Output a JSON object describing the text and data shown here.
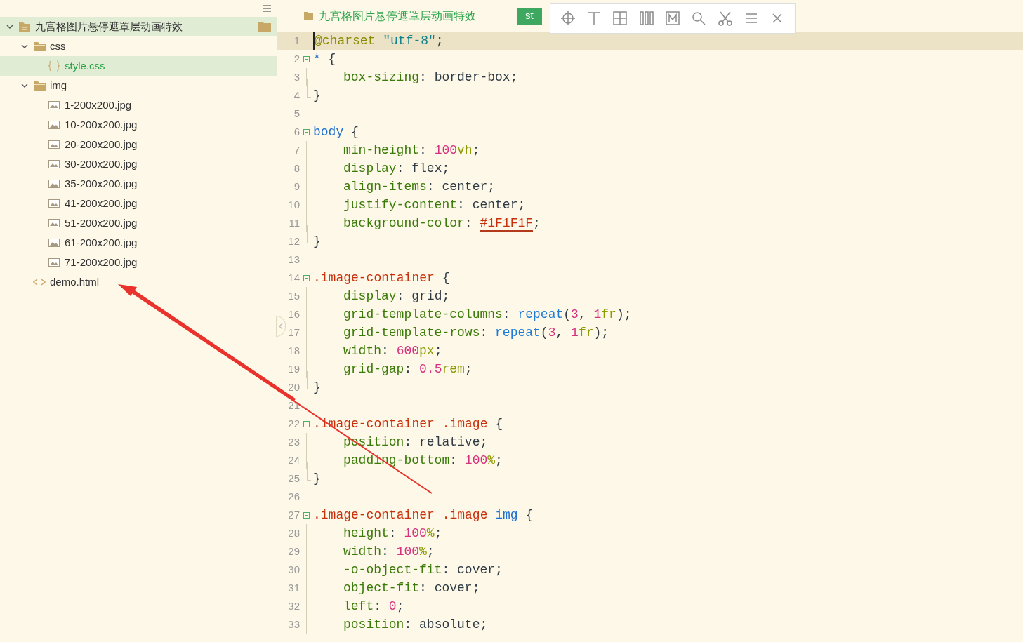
{
  "sidebar": {
    "tree": [
      {
        "name": "九宫格图片悬停遮罩层动画特效",
        "kind": "project",
        "expanded": true,
        "selected": true,
        "children": [
          {
            "name": "css",
            "kind": "folder",
            "expanded": true,
            "selected": false,
            "children": [
              {
                "name": "style.css",
                "kind": "css",
                "selected": true
              }
            ]
          },
          {
            "name": "img",
            "kind": "folder",
            "expanded": true,
            "selected": false,
            "children": [
              {
                "name": "1-200x200.jpg",
                "kind": "image",
                "selected": false
              },
              {
                "name": "10-200x200.jpg",
                "kind": "image",
                "selected": false
              },
              {
                "name": "20-200x200.jpg",
                "kind": "image",
                "selected": false
              },
              {
                "name": "30-200x200.jpg",
                "kind": "image",
                "selected": false
              },
              {
                "name": "35-200x200.jpg",
                "kind": "image",
                "selected": false
              },
              {
                "name": "41-200x200.jpg",
                "kind": "image",
                "selected": false
              },
              {
                "name": "51-200x200.jpg",
                "kind": "image",
                "selected": false
              },
              {
                "name": "61-200x200.jpg",
                "kind": "image",
                "selected": false
              },
              {
                "name": "71-200x200.jpg",
                "kind": "image",
                "selected": false
              }
            ]
          },
          {
            "name": "demo.html",
            "kind": "html",
            "selected": false
          }
        ]
      }
    ]
  },
  "editor": {
    "breadcrumb": "九宫格图片悬停遮罩层动画特效",
    "tabs": [
      {
        "label": "st",
        "selected": true
      }
    ],
    "lines": [
      {
        "number": "1",
        "kind": "plain",
        "current": true,
        "tokens": [
          {
            "kind": "at",
            "text": "@charset"
          },
          {
            "kind": "string",
            "text": " \"utf-8\""
          },
          {
            "kind": "plain",
            "text": ";"
          }
        ]
      },
      {
        "number": "2",
        "kind": "start",
        "current": false,
        "tokens": [
          {
            "kind": "tag",
            "text": "*"
          },
          {
            "kind": "plain",
            "text": " {"
          }
        ]
      },
      {
        "number": "3",
        "kind": "inside",
        "current": false,
        "tokens": [
          {
            "kind": "prop",
            "text": "box-sizing"
          },
          {
            "kind": "plain",
            "text": ": border-box;"
          }
        ]
      },
      {
        "number": "4",
        "kind": "end",
        "current": false,
        "tokens": [
          {
            "kind": "plain",
            "text": "}"
          }
        ]
      },
      {
        "number": "5",
        "kind": "plain",
        "current": false
      },
      {
        "number": "6",
        "kind": "start",
        "current": false,
        "tokens": [
          {
            "kind": "tag",
            "text": "body"
          },
          {
            "kind": "plain",
            "text": " {"
          }
        ]
      },
      {
        "number": "7",
        "kind": "inside",
        "current": false,
        "tokens": [
          {
            "kind": "prop",
            "text": "min-height"
          },
          {
            "kind": "plain",
            "text": ": "
          },
          {
            "kind": "number",
            "text": "100"
          },
          {
            "kind": "unit",
            "text": "vh"
          },
          {
            "kind": "plain",
            "text": ";"
          }
        ]
      },
      {
        "number": "8",
        "kind": "inside",
        "current": false,
        "tokens": [
          {
            "kind": "prop",
            "text": "display"
          },
          {
            "kind": "plain",
            "text": ": flex;"
          }
        ]
      },
      {
        "number": "9",
        "kind": "inside",
        "current": false,
        "tokens": [
          {
            "kind": "prop",
            "text": "align-items"
          },
          {
            "kind": "plain",
            "text": ": center;"
          }
        ]
      },
      {
        "number": "10",
        "kind": "inside",
        "current": false,
        "tokens": [
          {
            "kind": "prop",
            "text": "justify-content"
          },
          {
            "kind": "plain",
            "text": ": center;"
          }
        ]
      },
      {
        "number": "11",
        "kind": "inside",
        "current": false,
        "tokens": [
          {
            "kind": "prop",
            "text": "background-color"
          },
          {
            "kind": "plain",
            "text": ": "
          },
          {
            "kind": "hex",
            "text": "#1F1F1F"
          },
          {
            "kind": "plain",
            "text": ";"
          }
        ]
      },
      {
        "number": "12",
        "kind": "end",
        "current": false,
        "tokens": [
          {
            "kind": "plain",
            "text": "}"
          }
        ]
      },
      {
        "number": "13",
        "kind": "plain",
        "current": false
      },
      {
        "number": "14",
        "kind": "start",
        "current": false,
        "tokens": [
          {
            "kind": "selector",
            "text": ".image-container"
          },
          {
            "kind": "plain",
            "text": " {"
          }
        ]
      },
      {
        "number": "15",
        "kind": "inside",
        "current": false,
        "tokens": [
          {
            "kind": "prop",
            "text": "display"
          },
          {
            "kind": "plain",
            "text": ": grid;"
          }
        ]
      },
      {
        "number": "16",
        "kind": "inside",
        "current": false,
        "tokens": [
          {
            "kind": "prop",
            "text": "grid-template-columns"
          },
          {
            "kind": "plain",
            "text": ": "
          },
          {
            "kind": "func",
            "text": "repeat"
          },
          {
            "kind": "plain",
            "text": "("
          },
          {
            "kind": "number",
            "text": "3"
          },
          {
            "kind": "plain",
            "text": ", "
          },
          {
            "kind": "number",
            "text": "1"
          },
          {
            "kind": "unit",
            "text": "fr"
          },
          {
            "kind": "plain",
            "text": ");"
          }
        ]
      },
      {
        "number": "17",
        "kind": "inside",
        "current": false,
        "tokens": [
          {
            "kind": "prop",
            "text": "grid-template-rows"
          },
          {
            "kind": "plain",
            "text": ": "
          },
          {
            "kind": "func",
            "text": "repeat"
          },
          {
            "kind": "plain",
            "text": "("
          },
          {
            "kind": "number",
            "text": "3"
          },
          {
            "kind": "plain",
            "text": ", "
          },
          {
            "kind": "number",
            "text": "1"
          },
          {
            "kind": "unit",
            "text": "fr"
          },
          {
            "kind": "plain",
            "text": ");"
          }
        ]
      },
      {
        "number": "18",
        "kind": "inside",
        "current": false,
        "tokens": [
          {
            "kind": "prop",
            "text": "width"
          },
          {
            "kind": "plain",
            "text": ": "
          },
          {
            "kind": "number",
            "text": "600"
          },
          {
            "kind": "unit",
            "text": "px"
          },
          {
            "kind": "plain",
            "text": ";"
          }
        ]
      },
      {
        "number": "19",
        "kind": "inside",
        "current": false,
        "tokens": [
          {
            "kind": "prop",
            "text": "grid-gap"
          },
          {
            "kind": "plain",
            "text": ": "
          },
          {
            "kind": "number",
            "text": "0.5"
          },
          {
            "kind": "unit",
            "text": "rem"
          },
          {
            "kind": "plain",
            "text": ";"
          }
        ]
      },
      {
        "number": "20",
        "kind": "end",
        "current": false,
        "tokens": [
          {
            "kind": "plain",
            "text": "}"
          }
        ]
      },
      {
        "number": "21",
        "kind": "plain",
        "current": false
      },
      {
        "number": "22",
        "kind": "start",
        "current": false,
        "tokens": [
          {
            "kind": "selector",
            "text": ".image-container .image"
          },
          {
            "kind": "plain",
            "text": " {"
          }
        ]
      },
      {
        "number": "23",
        "kind": "inside",
        "current": false,
        "tokens": [
          {
            "kind": "prop",
            "text": "position"
          },
          {
            "kind": "plain",
            "text": ": relative;"
          }
        ]
      },
      {
        "number": "24",
        "kind": "inside",
        "current": false,
        "tokens": [
          {
            "kind": "prop",
            "text": "padding-bottom"
          },
          {
            "kind": "plain",
            "text": ": "
          },
          {
            "kind": "number",
            "text": "100"
          },
          {
            "kind": "unit",
            "text": "%"
          },
          {
            "kind": "plain",
            "text": ";"
          }
        ]
      },
      {
        "number": "25",
        "kind": "end",
        "current": false,
        "tokens": [
          {
            "kind": "plain",
            "text": "}"
          }
        ]
      },
      {
        "number": "26",
        "kind": "plain",
        "current": false
      },
      {
        "number": "27",
        "kind": "start",
        "current": false,
        "tokens": [
          {
            "kind": "selector",
            "text": ".image-container .image "
          },
          {
            "kind": "tag",
            "text": "img"
          },
          {
            "kind": "plain",
            "text": " {"
          }
        ]
      },
      {
        "number": "28",
        "kind": "inside",
        "current": false,
        "tokens": [
          {
            "kind": "prop",
            "text": "height"
          },
          {
            "kind": "plain",
            "text": ": "
          },
          {
            "kind": "number",
            "text": "100"
          },
          {
            "kind": "unit",
            "text": "%"
          },
          {
            "kind": "plain",
            "text": ";"
          }
        ]
      },
      {
        "number": "29",
        "kind": "inside",
        "current": false,
        "tokens": [
          {
            "kind": "prop",
            "text": "width"
          },
          {
            "kind": "plain",
            "text": ": "
          },
          {
            "kind": "number",
            "text": "100"
          },
          {
            "kind": "unit",
            "text": "%"
          },
          {
            "kind": "plain",
            "text": ";"
          }
        ]
      },
      {
        "number": "30",
        "kind": "inside",
        "current": false,
        "tokens": [
          {
            "kind": "prop",
            "text": "-o-object-fit"
          },
          {
            "kind": "plain",
            "text": ": cover;"
          }
        ]
      },
      {
        "number": "31",
        "kind": "inside",
        "current": false,
        "tokens": [
          {
            "kind": "prop",
            "text": "object-fit"
          },
          {
            "kind": "plain",
            "text": ": cover;"
          }
        ]
      },
      {
        "number": "32",
        "kind": "inside",
        "current": false,
        "tokens": [
          {
            "kind": "prop",
            "text": "left"
          },
          {
            "kind": "plain",
            "text": ": "
          },
          {
            "kind": "number",
            "text": "0"
          },
          {
            "kind": "plain",
            "text": ";"
          }
        ]
      },
      {
        "number": "33",
        "kind": "inside",
        "current": false,
        "tokens": [
          {
            "kind": "prop",
            "text": "position"
          },
          {
            "kind": "plain",
            "text": ": absolute;"
          }
        ]
      }
    ]
  }
}
